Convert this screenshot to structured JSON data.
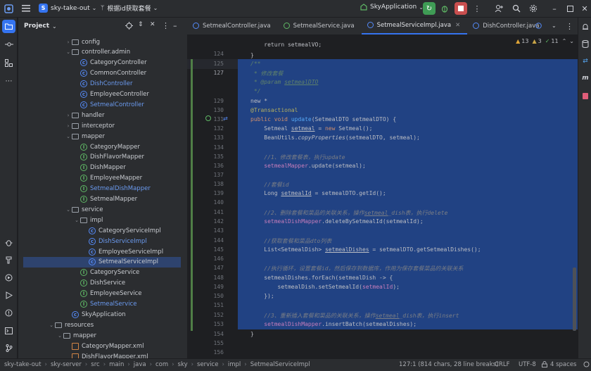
{
  "topbar": {
    "project_badge": "S",
    "project_name": "sky-take-out",
    "branch_label": "根据id获取套餐",
    "run_config": "SkyApplication"
  },
  "project_panel": {
    "title": "Project",
    "tree": [
      {
        "label": "config",
        "kind": "folder",
        "level": 6,
        "arrow": "›"
      },
      {
        "label": "controller.admin",
        "kind": "folder",
        "level": 6,
        "arrow": "⌄"
      },
      {
        "label": "CategoryController",
        "kind": "class",
        "level": 7
      },
      {
        "label": "CommonController",
        "kind": "class",
        "level": 7
      },
      {
        "label": "DishController",
        "kind": "class",
        "level": 7,
        "blue": true
      },
      {
        "label": "EmployeeController",
        "kind": "class",
        "level": 7
      },
      {
        "label": "SetmealController",
        "kind": "class",
        "level": 7,
        "blue": true
      },
      {
        "label": "handler",
        "kind": "folder",
        "level": 6,
        "arrow": "›"
      },
      {
        "label": "interceptor",
        "kind": "folder",
        "level": 6,
        "arrow": "›"
      },
      {
        "label": "mapper",
        "kind": "folder",
        "level": 6,
        "arrow": "⌄"
      },
      {
        "label": "CategoryMapper",
        "kind": "intf",
        "level": 7
      },
      {
        "label": "DishFlavorMapper",
        "kind": "intf",
        "level": 7
      },
      {
        "label": "DishMapper",
        "kind": "intf",
        "level": 7
      },
      {
        "label": "EmployeeMapper",
        "kind": "intf",
        "level": 7
      },
      {
        "label": "SetmealDishMapper",
        "kind": "intf",
        "level": 7,
        "blue": true
      },
      {
        "label": "SetmealMapper",
        "kind": "intf",
        "level": 7
      },
      {
        "label": "service",
        "kind": "folder",
        "level": 6,
        "arrow": "⌄"
      },
      {
        "label": "impl",
        "kind": "folder",
        "level": 7,
        "arrow": "⌄"
      },
      {
        "label": "CategoryServiceImpl",
        "kind": "class",
        "level": 8
      },
      {
        "label": "DishServiceImpl",
        "kind": "class",
        "level": 8,
        "blue": true
      },
      {
        "label": "EmployeeServiceImpl",
        "kind": "class",
        "level": 8
      },
      {
        "label": "SetmealServiceImpl",
        "kind": "class",
        "level": 8,
        "selected": true
      },
      {
        "label": "CategoryService",
        "kind": "intf",
        "level": 7
      },
      {
        "label": "DishService",
        "kind": "intf",
        "level": 7
      },
      {
        "label": "EmployeeService",
        "kind": "intf",
        "level": 7
      },
      {
        "label": "SetmealService",
        "kind": "intf",
        "level": 7,
        "blue": true
      },
      {
        "label": "SkyApplication",
        "kind": "class",
        "level": 6
      },
      {
        "label": "resources",
        "kind": "folder",
        "level": 4,
        "arrow": "⌄"
      },
      {
        "label": "mapper",
        "kind": "folder",
        "level": 5,
        "arrow": "⌄"
      },
      {
        "label": "CategoryMapper.xml",
        "kind": "xml",
        "level": 6
      },
      {
        "label": "DishFlavorMapper.xml",
        "kind": "xml",
        "level": 6
      }
    ]
  },
  "tabs": [
    {
      "label": "SetmealController.java",
      "active": false
    },
    {
      "label": "SetmealService.java",
      "active": false
    },
    {
      "label": "SetmealServiceImpl.java",
      "active": true
    },
    {
      "label": "DishController.java",
      "active": false
    }
  ],
  "inspections": {
    "warnings": "13",
    "weak": "3",
    "typos": "11"
  },
  "editor": {
    "line_numbers": [
      "",
      "124",
      "125",
      "127",
      "",
      "",
      "129",
      "130",
      "131",
      "132",
      "133",
      "134",
      "135",
      "136",
      "137",
      "138",
      "139",
      "140",
      "141",
      "142",
      "143",
      "144",
      "145",
      "146",
      "147",
      "148",
      "149",
      "150",
      "151",
      "152",
      "153",
      "154",
      "155",
      "156"
    ],
    "author_hint": "new *"
  },
  "status": {
    "breadcrumbs": [
      "sky-take-out",
      "sky-server",
      "src",
      "main",
      "java",
      "com",
      "sky",
      "service",
      "impl",
      "SetmealServiceImpl"
    ],
    "position": "127:1 (814 chars, 28 line breaks)",
    "line_sep": "CRLF",
    "encoding": "UTF-8",
    "indent": "4 spaces"
  }
}
